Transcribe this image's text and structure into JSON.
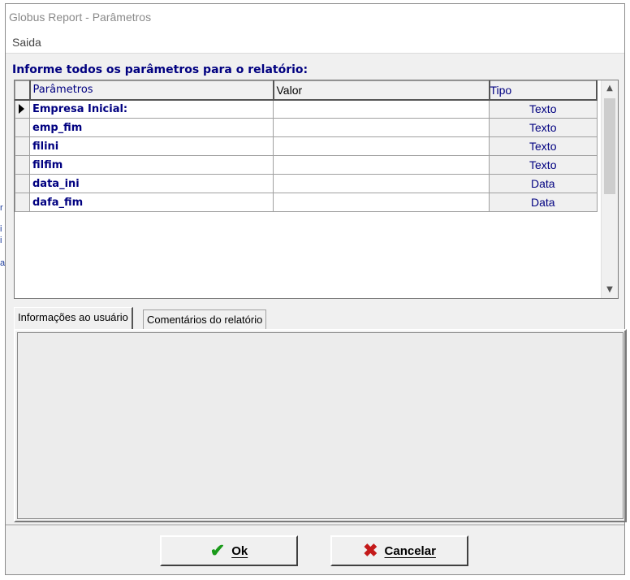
{
  "window": {
    "title": "Globus Report - Parâmetros",
    "menu": [
      "Saida"
    ]
  },
  "prompt": "Informe todos os parâmetros para o relatório:",
  "grid": {
    "columns": [
      "Parâmetros",
      "Valor",
      "Tipo"
    ],
    "rows": [
      {
        "param": "Empresa Inicial:",
        "valor": "",
        "tipo": "Texto",
        "current": true
      },
      {
        "param": "emp_fim",
        "valor": "",
        "tipo": "Texto"
      },
      {
        "param": "filini",
        "valor": "",
        "tipo": "Texto"
      },
      {
        "param": "filfim",
        "valor": "",
        "tipo": "Texto"
      },
      {
        "param": "data_ini",
        "valor": "",
        "tipo": "Data"
      },
      {
        "param": "dafa_fim",
        "valor": "",
        "tipo": "Data"
      }
    ]
  },
  "tabs": [
    "Informações ao usuário",
    "Comentários do relatório"
  ],
  "buttons": {
    "ok": "Ok",
    "cancel": "Cancelar"
  },
  "icons": {
    "ok": "check-icon",
    "cancel": "x-icon",
    "row_indicator": "row-pointer-icon"
  }
}
